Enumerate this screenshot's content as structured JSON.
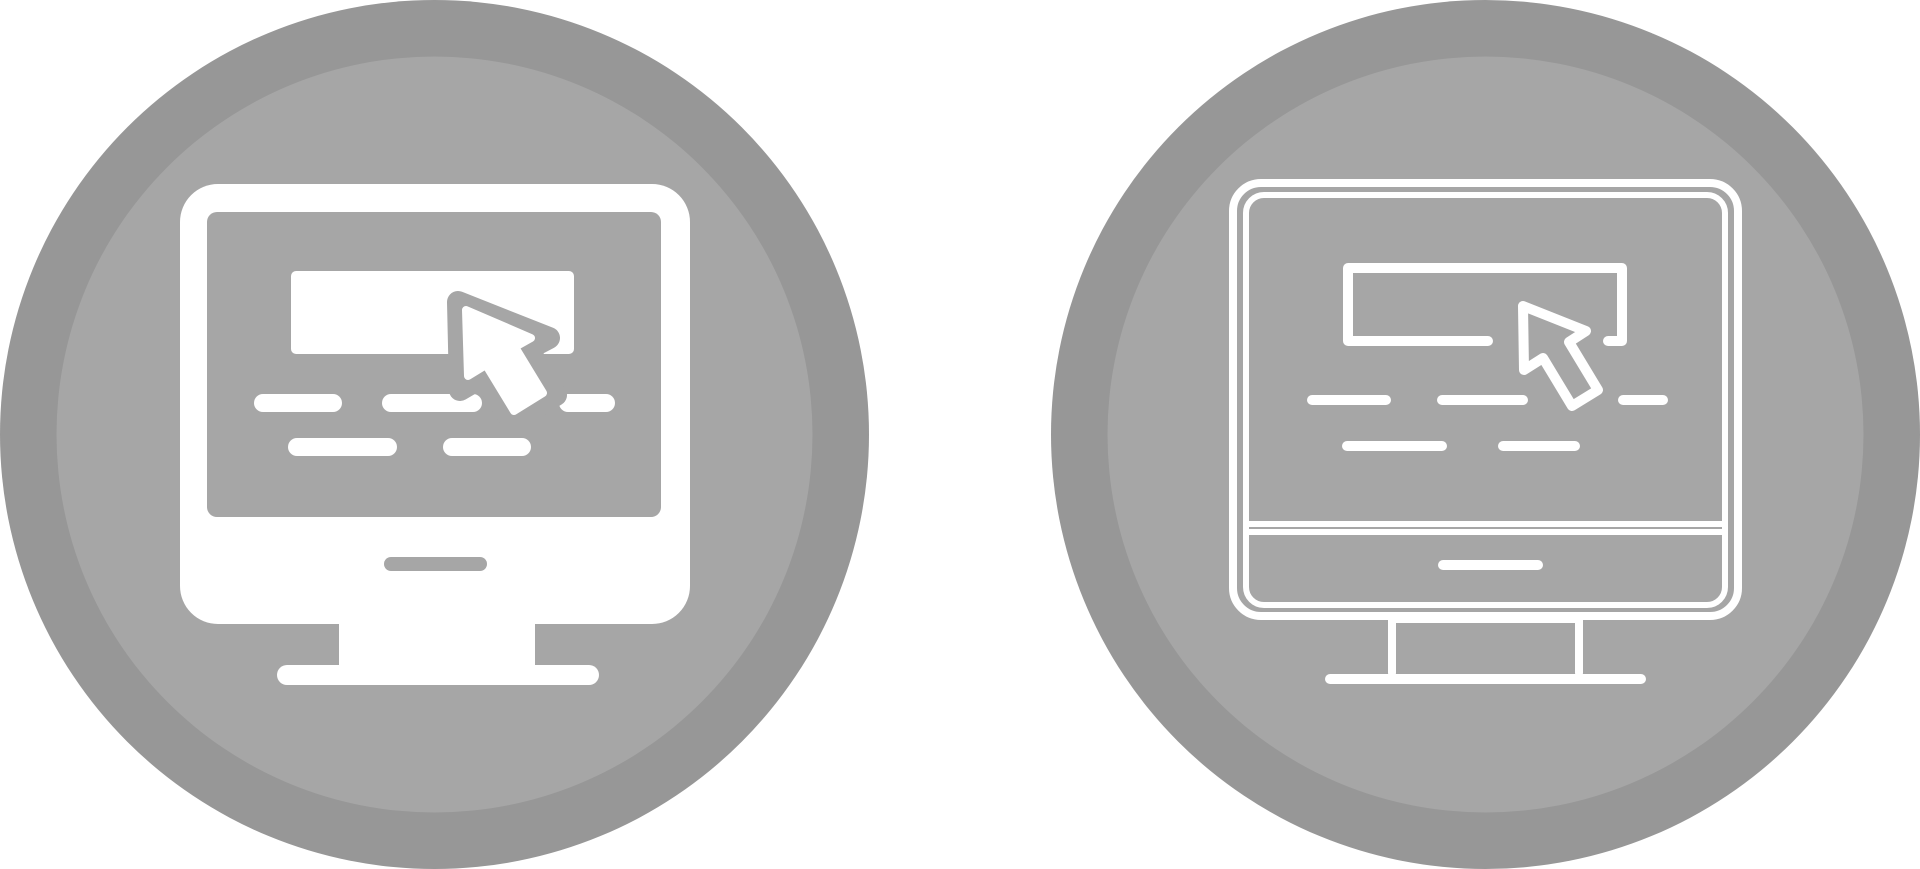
{
  "colors": {
    "background": "#ffffff",
    "outer_ring": "#979797",
    "inner_disc": "#a6a6a6",
    "glyph": "#ffffff"
  },
  "icons": [
    {
      "name": "computer-click-solid-icon",
      "style": "solid"
    },
    {
      "name": "computer-click-outline-icon",
      "style": "outline"
    }
  ]
}
